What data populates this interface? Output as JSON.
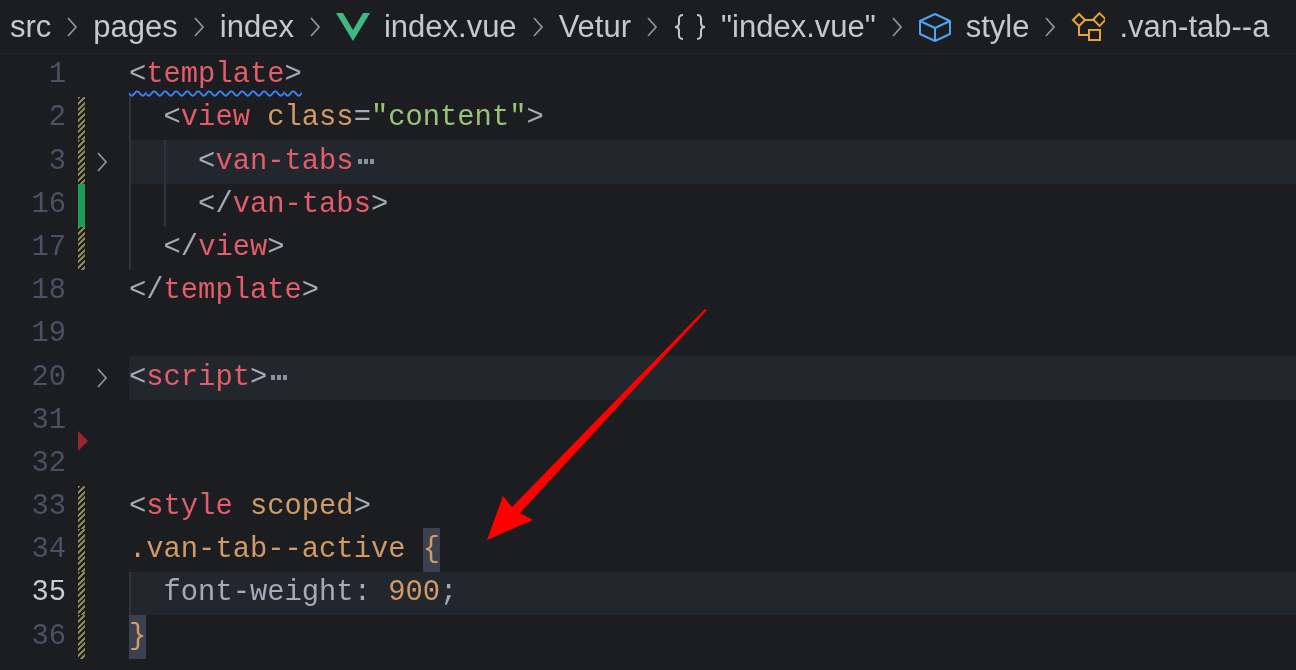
{
  "breadcrumb": [
    {
      "kind": "plain",
      "label": "src"
    },
    {
      "kind": "plain",
      "label": "pages"
    },
    {
      "kind": "plain",
      "label": "index"
    },
    {
      "kind": "vue",
      "label": "index.vue"
    },
    {
      "kind": "plain",
      "label": "Vetur"
    },
    {
      "kind": "braces",
      "label": "\"index.vue\""
    },
    {
      "kind": "cube",
      "label": "style"
    },
    {
      "kind": "selector",
      "label": ".van-tab--a"
    }
  ],
  "annotation": {
    "kind": "arrow",
    "color": "#ff0000"
  },
  "lines": [
    {
      "number": "1",
      "modified": false,
      "added": false,
      "deleted": false,
      "folded": false,
      "current": false,
      "squiggle": true,
      "tokens": [
        {
          "kind": "punct",
          "text": "<"
        },
        {
          "kind": "tag",
          "text": "template"
        },
        {
          "kind": "punct",
          "text": ">"
        }
      ]
    },
    {
      "number": "2",
      "modified": true,
      "added": false,
      "deleted": false,
      "folded": false,
      "current": false,
      "tokens": [
        {
          "kind": "punct",
          "text": "  <"
        },
        {
          "kind": "tag",
          "text": "view"
        },
        {
          "kind": "attr",
          "text": " class"
        },
        {
          "kind": "punct",
          "text": "="
        },
        {
          "kind": "string",
          "text": "\"content\""
        },
        {
          "kind": "punct",
          "text": ">"
        }
      ]
    },
    {
      "number": "3",
      "modified": true,
      "added": false,
      "deleted": false,
      "folded": true,
      "current": false,
      "tokens": [
        {
          "kind": "punct",
          "text": "    <"
        },
        {
          "kind": "tag",
          "text": "van-tabs"
        }
      ]
    },
    {
      "number": "16",
      "modified": false,
      "added": true,
      "deleted": false,
      "folded": false,
      "current": false,
      "tokens": [
        {
          "kind": "punct",
          "text": "    </"
        },
        {
          "kind": "tag",
          "text": "van-tabs"
        },
        {
          "kind": "punct",
          "text": ">"
        }
      ]
    },
    {
      "number": "17",
      "modified": true,
      "added": false,
      "deleted": false,
      "folded": false,
      "current": false,
      "tokens": [
        {
          "kind": "punct",
          "text": "  </"
        },
        {
          "kind": "tag",
          "text": "view"
        },
        {
          "kind": "punct",
          "text": ">"
        }
      ]
    },
    {
      "number": "18",
      "modified": false,
      "added": false,
      "deleted": false,
      "folded": false,
      "current": false,
      "tokens": [
        {
          "kind": "punct",
          "text": "</"
        },
        {
          "kind": "tag",
          "text": "template"
        },
        {
          "kind": "punct",
          "text": ">"
        }
      ]
    },
    {
      "number": "19",
      "modified": false,
      "added": false,
      "deleted": false,
      "folded": false,
      "current": false
    },
    {
      "number": "20",
      "modified": false,
      "added": false,
      "deleted": false,
      "folded": true,
      "current": false,
      "tokens": [
        {
          "kind": "punct",
          "text": "<"
        },
        {
          "kind": "tag",
          "text": "script"
        },
        {
          "kind": "punct",
          "text": ">"
        }
      ]
    },
    {
      "number": "31",
      "modified": false,
      "added": false,
      "deleted": false,
      "folded": false,
      "current": false
    },
    {
      "number": "32",
      "modified": false,
      "added": false,
      "deleted": true,
      "folded": false,
      "current": false
    },
    {
      "number": "33",
      "modified": true,
      "added": false,
      "deleted": false,
      "folded": false,
      "current": false,
      "tokens": [
        {
          "kind": "punct",
          "text": "<"
        },
        {
          "kind": "tag",
          "text": "style"
        },
        {
          "kind": "attr",
          "text": " scoped"
        },
        {
          "kind": "punct",
          "text": ">"
        }
      ]
    },
    {
      "number": "34",
      "modified": true,
      "added": false,
      "deleted": false,
      "folded": false,
      "current": false,
      "tokens": [
        {
          "kind": "selector",
          "text": ".van-tab--active "
        },
        {
          "kind": "selector",
          "text": "{",
          "matched": true
        }
      ]
    },
    {
      "number": "35",
      "modified": true,
      "added": false,
      "deleted": false,
      "folded": false,
      "current": true,
      "tokens": [
        {
          "kind": "property",
          "text": "  font-weight: "
        },
        {
          "kind": "number",
          "text": "900"
        },
        {
          "kind": "property",
          "text": ";"
        }
      ]
    },
    {
      "number": "36",
      "modified": true,
      "added": false,
      "deleted": false,
      "folded": false,
      "current": false,
      "tokens": [
        {
          "kind": "selector",
          "text": "}",
          "matched": true
        }
      ]
    }
  ]
}
